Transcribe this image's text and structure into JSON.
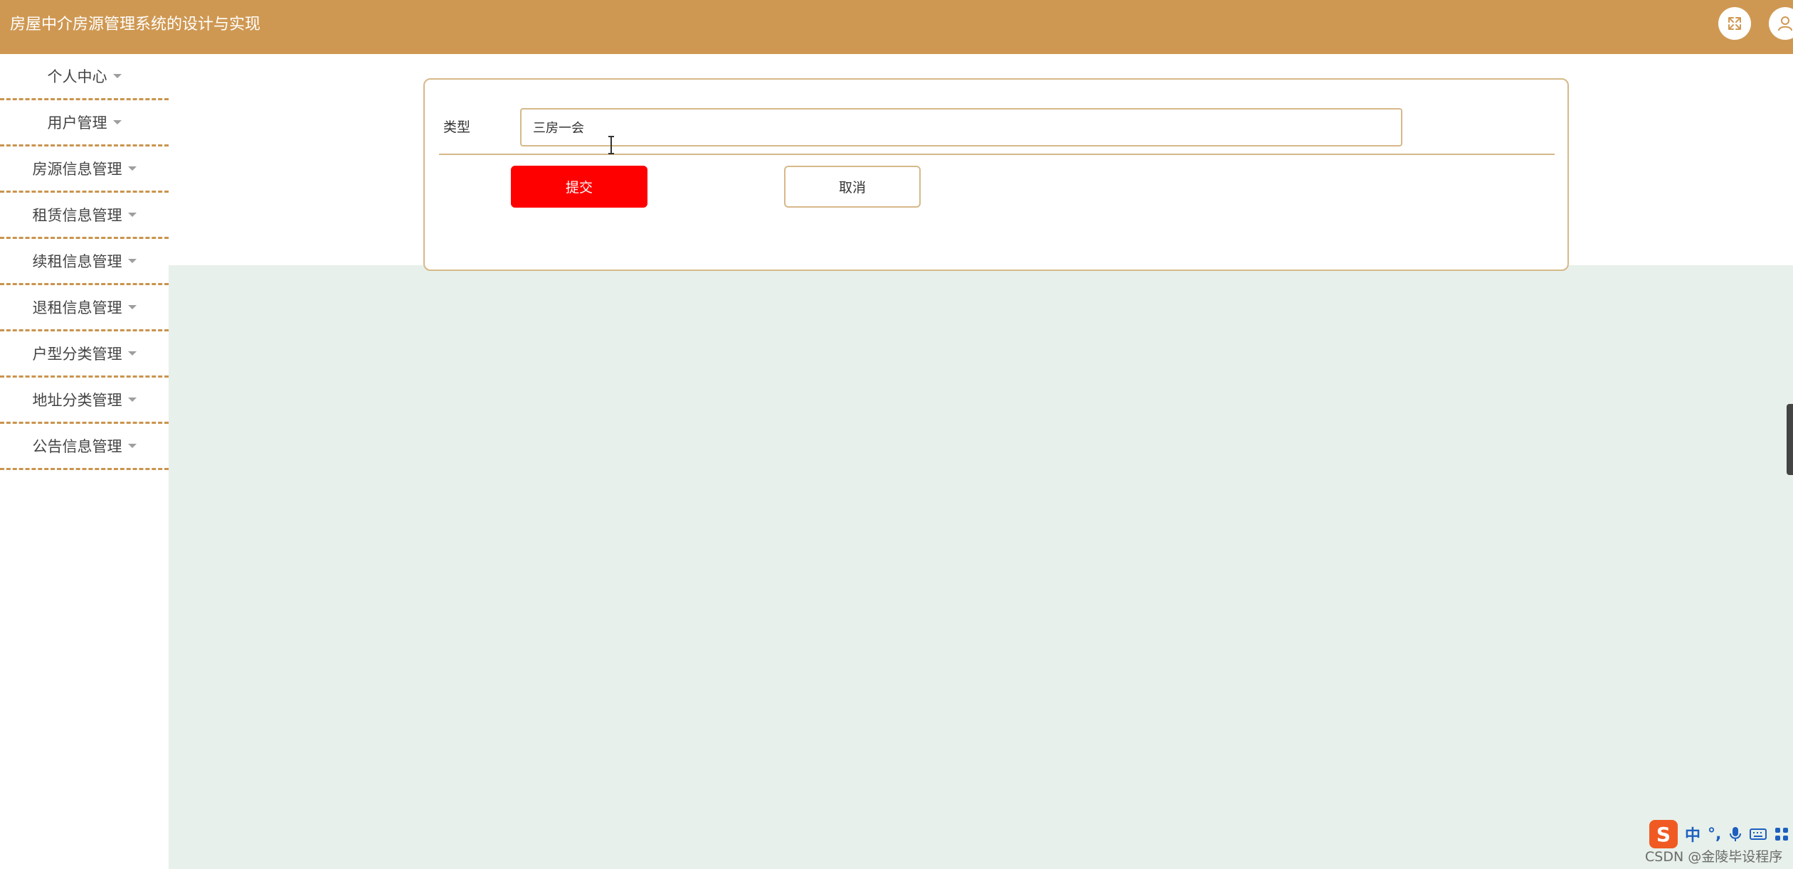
{
  "header": {
    "title": "房屋中介房源管理系统的设计与实现",
    "bg_color": "#cf9852",
    "buttons": [
      "expand-icon",
      "user-icon"
    ]
  },
  "sidebar": {
    "items": [
      {
        "label": "个人中心"
      },
      {
        "label": "用户管理"
      },
      {
        "label": "房源信息管理"
      },
      {
        "label": "租赁信息管理"
      },
      {
        "label": "续租信息管理"
      },
      {
        "label": "退租信息管理"
      },
      {
        "label": "户型分类管理"
      },
      {
        "label": "地址分类管理"
      },
      {
        "label": "公告信息管理"
      }
    ],
    "divider_color": "#c9944e"
  },
  "form": {
    "type_label": "类型",
    "type_value": "三房一会",
    "submit_label": "提交",
    "submit_color": "#ff0000",
    "cancel_label": "取消",
    "border_color": "#d6b98a"
  },
  "content": {
    "bg_color": "#e7f0ea"
  },
  "ime": {
    "logo": "S",
    "mode": "中",
    "punct": "°,",
    "icons": [
      "microphone-icon",
      "keyboard-icon",
      "grid-icon"
    ]
  },
  "watermark": "CSDN @金陵毕设程序"
}
